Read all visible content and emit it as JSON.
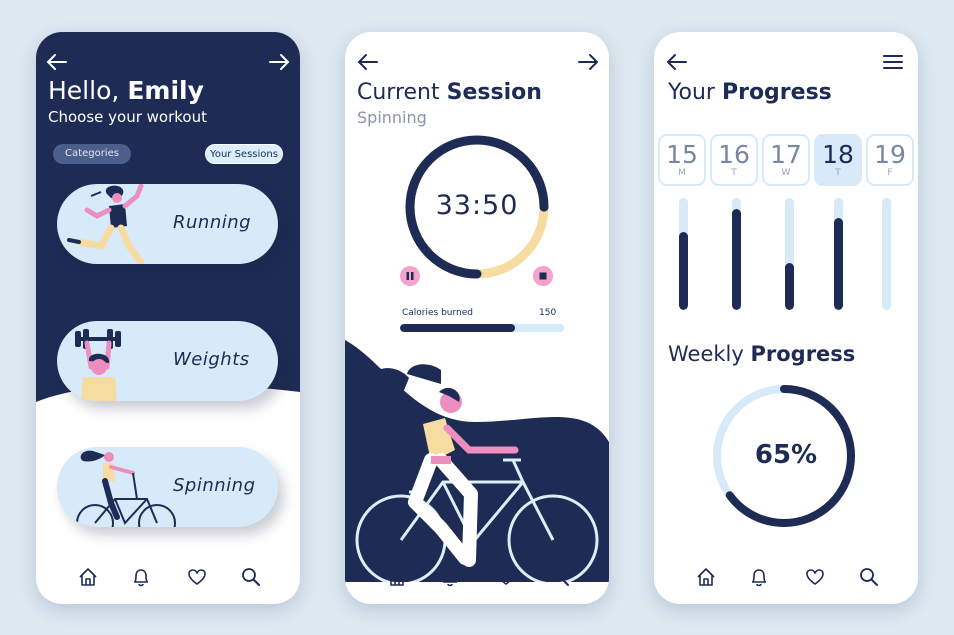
{
  "colors": {
    "navy": "#1e2b55",
    "light_blue": "#d6eafa",
    "peach": "#f7dca2",
    "pink": "#ec8fbf",
    "background": "#dde8f1"
  },
  "workout": {
    "greeting": "Hello,",
    "name": "Emily",
    "subtitle": "Choose your workout",
    "tabs": {
      "categories": "Categories",
      "sessions": "Your Sessions"
    },
    "cards": [
      {
        "label": "Running",
        "icon": "runner-illustration"
      },
      {
        "label": "Weights",
        "icon": "weightlifter-illustration"
      },
      {
        "label": "Spinning",
        "icon": "cyclist-illustration"
      }
    ]
  },
  "session": {
    "title_light": "Current",
    "title_bold": "Session",
    "subtitle": "Spinning",
    "timer": "33:50",
    "timer_progress": 0.75,
    "calories_label": "Calories burned",
    "calories_value": "150",
    "calories_progress": 0.7
  },
  "progress": {
    "title_light": "Your",
    "title_bold": "Progress",
    "days": [
      {
        "num": "15",
        "letter": "M",
        "level": 0.7
      },
      {
        "num": "16",
        "letter": "T",
        "level": 0.9
      },
      {
        "num": "17",
        "letter": "W",
        "level": 0.42
      },
      {
        "num": "18",
        "letter": "T",
        "level": 0.82,
        "selected": true
      },
      {
        "num": "19",
        "letter": "F",
        "level": 0
      }
    ],
    "weekly_light": "Weekly",
    "weekly_bold": "Progress",
    "weekly_percent": "65%",
    "weekly_value": 0.65
  },
  "nav_icons": [
    "home-icon",
    "bell-icon",
    "heart-icon",
    "search-icon"
  ]
}
